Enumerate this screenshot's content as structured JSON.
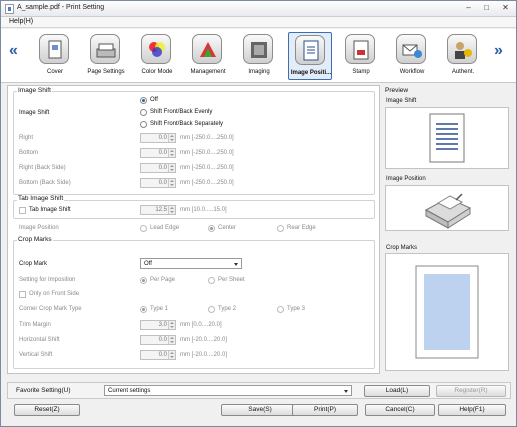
{
  "window": {
    "title": "A_sample.pdf - Print Setting",
    "minimize": "–",
    "maximize": "□",
    "close": "✕"
  },
  "menu": {
    "help": "Help(H)"
  },
  "nav": {
    "prev": "«",
    "next": "»"
  },
  "tabs": [
    {
      "label": "Cover",
      "icon": "cover-icon"
    },
    {
      "label": "Page Settings",
      "icon": "page-settings-icon"
    },
    {
      "label": "Color Mode",
      "icon": "color-mode-icon"
    },
    {
      "label": "Management",
      "icon": "management-icon"
    },
    {
      "label": "Imaging",
      "icon": "imaging-icon"
    },
    {
      "label": "Image Positi...",
      "icon": "image-position-icon",
      "active": true
    },
    {
      "label": "Stamp",
      "icon": "stamp-icon"
    },
    {
      "label": "Workflow",
      "icon": "workflow-icon"
    },
    {
      "label": "Authent.",
      "icon": "authentication-icon"
    }
  ],
  "image_shift": {
    "title": "Image Shift",
    "label": "Image Shift",
    "options": [
      "Off",
      "Shift Front/Back Evenly",
      "Shift Front/Back Separately"
    ],
    "selected": "Off",
    "fields": [
      {
        "label": "Right",
        "value": "0.0",
        "range": "mm [-250.0....250.0]"
      },
      {
        "label": "Bottom",
        "value": "0.0",
        "range": "mm [-250.0....250.0]"
      },
      {
        "label": "Right (Back Side)",
        "value": "0.0",
        "range": "mm [-250.0....250.0]"
      },
      {
        "label": "Bottom (Back Side)",
        "value": "0.0",
        "range": "mm [-250.0....250.0]"
      }
    ]
  },
  "tab_image_shift": {
    "title": "Tab Image Shift",
    "checkbox": "Tab Image Shift",
    "value": "12.5",
    "range": "mm [10.0.....15.0]"
  },
  "image_position": {
    "label": "Image Position",
    "options": [
      "Lead Edge",
      "Center",
      "Rear Edge"
    ],
    "selected": "Center"
  },
  "crop_marks": {
    "title": "Crop Marks",
    "label": "Crop Mark",
    "select_value": "Off",
    "imposition_label": "Setting for Imposition",
    "imposition_options": [
      "Per Page",
      "Per Sheet"
    ],
    "imposition_selected": "Per Page",
    "front_only": "Only on Front Side",
    "corner_label": "Corner Crop Mark Type",
    "corner_options": [
      "Type 1",
      "Type 2",
      "Type 3"
    ],
    "corner_selected": "Type 1",
    "fields": [
      {
        "label": "Trim Margin",
        "value": "3.0",
        "range": "mm [0.0....20.0]"
      },
      {
        "label": "Horizontal Shift",
        "value": "0.0",
        "range": "mm [-20.0....20.0]"
      },
      {
        "label": "Vertical Shift",
        "value": "0.0",
        "range": "mm [-20.0....20.0]"
      }
    ]
  },
  "preview": {
    "title": "Preview",
    "image_shift": "Image Shift",
    "image_position": "Image Position",
    "crop_marks": "Crop Marks"
  },
  "favorite": {
    "label": "Favorite Setting(U)",
    "value": "Current settings",
    "load": "Load(L)",
    "register": "Register(R)"
  },
  "footer": {
    "reset": "Reset(Z)",
    "save": "Save(S)",
    "print": "Print(P)",
    "cancel": "Cancel(C)",
    "help": "Help(F1)"
  },
  "colors": {
    "accent": "#2a5fb8",
    "active_tab_bg": "#e3edfa",
    "crop_preview_fill": "#bcd2ee"
  }
}
